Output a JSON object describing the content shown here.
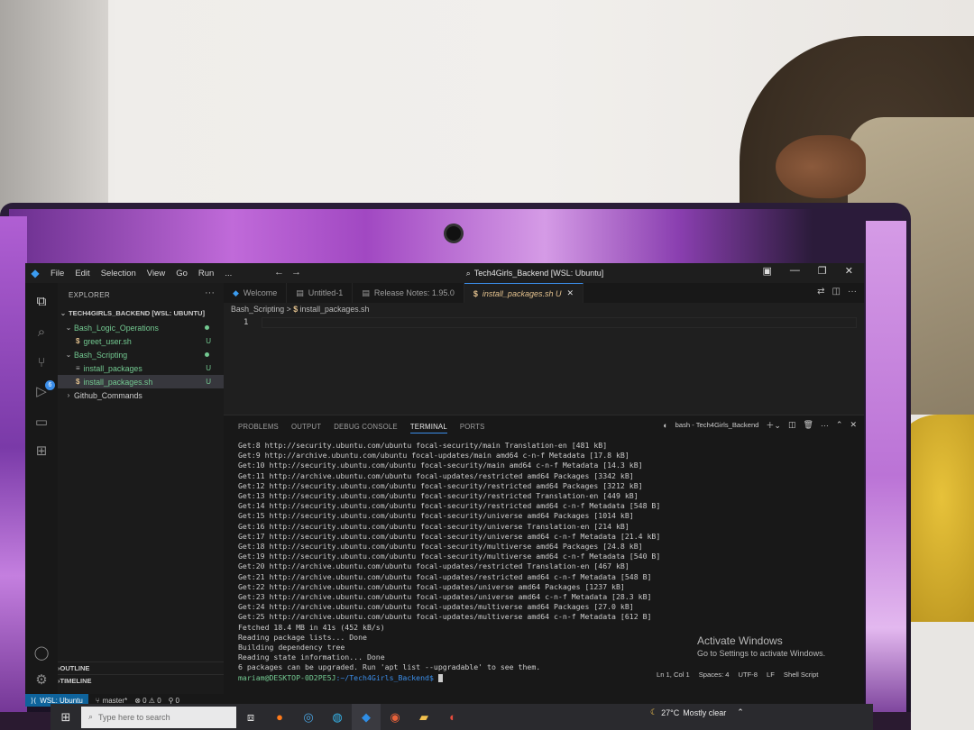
{
  "window": {
    "title": "Tech4Girls_Backend [WSL: Ubuntu]",
    "menu": [
      "File",
      "Edit",
      "Selection",
      "View",
      "Go",
      "Run",
      "..."
    ]
  },
  "explorer": {
    "header": "EXPLORER",
    "root": "TECH4GIRLS_BACKEND [WSL: UBUNTU]",
    "items": [
      {
        "label": "Bash_Logic_Operations",
        "status": "dot"
      },
      {
        "label": "greet_user.sh",
        "status": "U"
      },
      {
        "label": "Bash_Scripting",
        "status": "dot"
      },
      {
        "label": "install_packages",
        "status": "U"
      },
      {
        "label": "install_packages.sh",
        "status": "U"
      },
      {
        "label": "Github_Commands",
        "status": ""
      }
    ],
    "outline": "OUTLINE",
    "timeline": "TIMELINE"
  },
  "tabs": [
    {
      "label": "Welcome",
      "icon": "vscode-icon"
    },
    {
      "label": "Untitled-1",
      "icon": "file-icon"
    },
    {
      "label": "Release Notes: 1.95.0",
      "icon": "file-icon"
    },
    {
      "label": "install_packages.sh U",
      "icon": "dollar-icon"
    }
  ],
  "breadcrumb": {
    "folder": "Bash_Scripting",
    "sep": ">",
    "file": "install_packages.sh"
  },
  "editor": {
    "line": "1"
  },
  "panel": {
    "tabs": [
      "PROBLEMS",
      "OUTPUT",
      "DEBUG CONSOLE",
      "TERMINAL",
      "PORTS"
    ],
    "active": "TERMINAL",
    "terminal_name": "bash - Tech4Girls_Backend"
  },
  "terminal": {
    "lines": [
      "Get:8 http://security.ubuntu.com/ubuntu focal-security/main Translation-en [481 kB]",
      "Get:9 http://archive.ubuntu.com/ubuntu focal-updates/main amd64 c-n-f Metadata [17.8 kB]",
      "Get:10 http://security.ubuntu.com/ubuntu focal-security/main amd64 c-n-f Metadata [14.3 kB]",
      "Get:11 http://archive.ubuntu.com/ubuntu focal-updates/restricted amd64 Packages [3342 kB]",
      "Get:12 http://security.ubuntu.com/ubuntu focal-security/restricted amd64 Packages [3212 kB]",
      "Get:13 http://security.ubuntu.com/ubuntu focal-security/restricted Translation-en [449 kB]",
      "Get:14 http://security.ubuntu.com/ubuntu focal-security/restricted amd64 c-n-f Metadata [548 B]",
      "Get:15 http://security.ubuntu.com/ubuntu focal-security/universe amd64 Packages [1014 kB]",
      "Get:16 http://security.ubuntu.com/ubuntu focal-security/universe Translation-en [214 kB]",
      "Get:17 http://security.ubuntu.com/ubuntu focal-security/universe amd64 c-n-f Metadata [21.4 kB]",
      "Get:18 http://security.ubuntu.com/ubuntu focal-security/multiverse amd64 Packages [24.8 kB]",
      "Get:19 http://security.ubuntu.com/ubuntu focal-security/multiverse amd64 c-n-f Metadata [540 B]",
      "Get:20 http://archive.ubuntu.com/ubuntu focal-updates/restricted Translation-en [467 kB]",
      "Get:21 http://archive.ubuntu.com/ubuntu focal-updates/restricted amd64 c-n-f Metadata [548 B]",
      "Get:22 http://archive.ubuntu.com/ubuntu focal-updates/universe amd64 Packages [1237 kB]",
      "Get:23 http://archive.ubuntu.com/ubuntu focal-updates/universe amd64 c-n-f Metadata [28.3 kB]",
      "Get:24 http://archive.ubuntu.com/ubuntu focal-updates/multiverse amd64 Packages [27.0 kB]",
      "Get:25 http://archive.ubuntu.com/ubuntu focal-updates/multiverse amd64 c-n-f Metadata [612 B]",
      "Fetched 18.4 MB in 41s (452 kB/s)",
      "Reading package lists... Done",
      "Building dependency tree",
      "Reading state information... Done",
      "6 packages can be upgraded. Run 'apt list --upgradable' to see them."
    ],
    "prompt_user": "mariam@DESKTOP-0D2PE5J",
    "prompt_path": ":~/Tech4Girls_Backend$"
  },
  "activate": {
    "title": "Activate Windows",
    "subtitle": "Go to Settings to activate Windows."
  },
  "editor_status": [
    "Ln 1, Col 1",
    "Spaces: 4",
    "UTF-8",
    "LF",
    "Shell Script"
  ],
  "statusbar": {
    "remote": "WSL: Ubuntu",
    "branch": "master*",
    "problems": "⊗ 0 ⚠ 0",
    "ports": "0"
  },
  "taskbar": {
    "search_placeholder": "Type here to search",
    "temp": "27°C",
    "weather": "Mostly clear"
  }
}
